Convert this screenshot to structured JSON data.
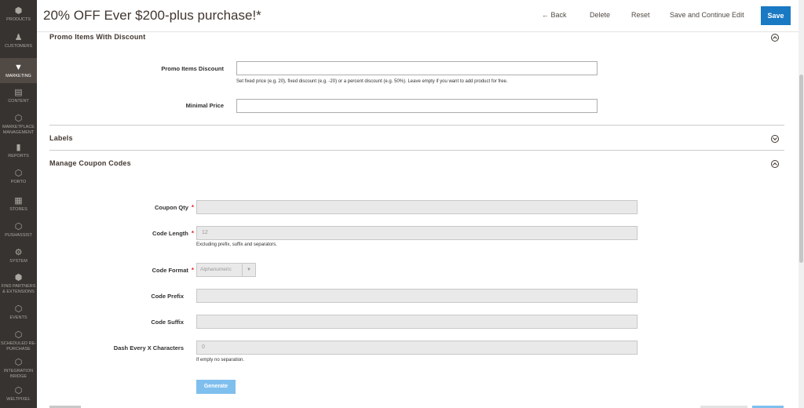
{
  "sidebar": {
    "items": [
      {
        "label": "PRODUCTS",
        "icon": "cube-icon",
        "glyph": "⬢"
      },
      {
        "label": "CUSTOMERS",
        "icon": "person-icon",
        "glyph": "♟"
      },
      {
        "label": "MARKETING",
        "icon": "megaphone-icon",
        "glyph": "📢",
        "active": true
      },
      {
        "label": "CONTENT",
        "icon": "content-icon",
        "glyph": "▤"
      },
      {
        "label": "MARKETPLACE MANAGEMENT",
        "icon": "hexagon-icon",
        "glyph": "⬡"
      },
      {
        "label": "REPORTS",
        "icon": "bar-chart-icon",
        "glyph": "▮"
      },
      {
        "label": "PORTO",
        "icon": "hexagon-icon",
        "glyph": "⬡"
      },
      {
        "label": "STORES",
        "icon": "store-icon",
        "glyph": "▦"
      },
      {
        "label": "PUSHASSIST",
        "icon": "hexagon-icon",
        "glyph": "⬡"
      },
      {
        "label": "SYSTEM",
        "icon": "gear-icon",
        "glyph": "⚙"
      },
      {
        "label": "FIND PARTNERS & EXTENSIONS",
        "icon": "box-icon",
        "glyph": "⬢"
      },
      {
        "label": "EVENTS",
        "icon": "hexagon-icon",
        "glyph": "⬡"
      },
      {
        "label": "SCHEDULED RE-PURCHASE",
        "icon": "hexagon-icon",
        "glyph": "⬡"
      },
      {
        "label": "INTEGRATION BRIDGE",
        "icon": "hexagon-icon",
        "glyph": "⬡"
      },
      {
        "label": "WELTPIXEL",
        "icon": "hexagon-icon",
        "glyph": "⬡"
      }
    ]
  },
  "header": {
    "title": "20% OFF Ever $200-plus purchase!*",
    "back_label": "Back",
    "back_icon": "arrow-left-icon",
    "delete_label": "Delete",
    "reset_label": "Reset",
    "save_continue_label": "Save and Continue Edit",
    "save_label": "Save"
  },
  "promo_section": {
    "title": "Promo Items With Discount",
    "discount_label": "Promo Items Discount",
    "discount_value": "",
    "discount_note": "Set fixed price (e.g. 20), fixed discount (e.g. -20) or a percent discount (e.g. 50%). Leave empty if you want to add product for free.",
    "min_price_label": "Minimal Price",
    "min_price_value": ""
  },
  "labels_section": {
    "title": "Labels"
  },
  "coupon_section": {
    "title": "Manage Coupon Codes",
    "qty_label": "Coupon Qty",
    "qty_value": "",
    "length_label": "Code Length",
    "length_value": "12",
    "length_note": "Excluding prefix, suffix and separators.",
    "format_label": "Code Format",
    "format_value": "Alphanumeric",
    "prefix_label": "Code Prefix",
    "prefix_value": "",
    "suffix_label": "Code Suffix",
    "suffix_value": "",
    "dash_label": "Dash Every X Characters",
    "dash_value": "0",
    "dash_note": "If empty no separation.",
    "generate_label": "Generate",
    "required_mark": "*"
  },
  "colors": {
    "sidebar_bg": "#373330",
    "accent": "#1979c3",
    "generate_btn": "#7fbfee",
    "required": "#e22626"
  }
}
